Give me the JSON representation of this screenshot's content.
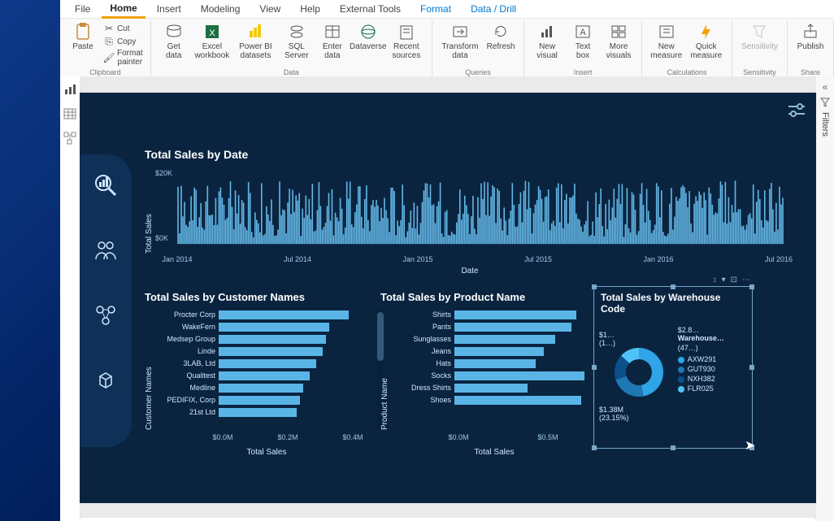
{
  "menubar": {
    "file": "File",
    "home": "Home",
    "insert": "Insert",
    "modeling": "Modeling",
    "view": "View",
    "help": "Help",
    "external_tools": "External Tools",
    "format": "Format",
    "data_drill": "Data / Drill"
  },
  "ribbon": {
    "paste": "Paste",
    "cut": "Cut",
    "copy": "Copy",
    "format_painter": "Format painter",
    "clipboard_group": "Clipboard",
    "get_data": "Get data",
    "excel_wb": "Excel workbook",
    "pbi_ds": "Power BI datasets",
    "sql_server": "SQL Server",
    "enter_data": "Enter data",
    "dataverse": "Dataverse",
    "recent_sources": "Recent sources",
    "data_group": "Data",
    "transform_data": "Transform data",
    "refresh": "Refresh",
    "queries_group": "Queries",
    "new_visual": "New visual",
    "text_box": "Text box",
    "more_visuals": "More visuals",
    "insert_group": "Insert",
    "new_measure": "New measure",
    "quick_measure": "Quick measure",
    "calc_group": "Calculations",
    "sensitivity": "Sensitivity",
    "sensitivity_group": "Sensitivity",
    "publish": "Publish",
    "share_group": "Share"
  },
  "side": {
    "filters": "Filters"
  },
  "report": {
    "ts_title": "Total Sales by Date",
    "ts_ylabel": "Total Sales",
    "ts_xlabel": "Date",
    "cust_title": "Total Sales by Customer Names",
    "cust_ylabel": "Customer Names",
    "cust_xlabel": "Total Sales",
    "prod_title": "Total Sales by Product Name",
    "prod_ylabel": "Product Name",
    "prod_xlabel": "Total Sales",
    "wh_title": "Total Sales by Warehouse Code",
    "wh_legend_header": "Warehouse…",
    "wh_val1": "$1…",
    "wh_val1b": "(1…)",
    "wh_val2": "$2.8…",
    "wh_val2b": "(47…)",
    "wh_val3": "$1.38M",
    "wh_val3b": "(23.15%)"
  },
  "chart_data": [
    {
      "id": "ts_by_date",
      "type": "bar",
      "title": "Total Sales by Date",
      "xlabel": "Date",
      "ylabel": "Total Sales",
      "ylim": [
        0,
        20000
      ],
      "x_ticks": [
        "Jan 2014",
        "Jul 2014",
        "Jan 2015",
        "Jul 2015",
        "Jan 2016",
        "Jul 2016"
      ],
      "y_ticks": [
        "$0K",
        "$20K"
      ],
      "notes": "Dense daily bars, values roughly 2K–20K; not individually legible."
    },
    {
      "id": "ts_by_customer",
      "type": "bar",
      "orientation": "horizontal",
      "title": "Total Sales by Customer Names",
      "xlabel": "Total Sales",
      "ylabel": "Customer Names",
      "xlim": [
        0,
        0.4
      ],
      "x_ticks": [
        "$0.0M",
        "$0.2M",
        "$0.4M"
      ],
      "categories": [
        "Procter Corp",
        "WakeFern",
        "Medsep Group",
        "Linde",
        "3LAB, Ltd",
        "Qualitest",
        "Medline",
        "PEDIFIX, Corp",
        "21st Ltd"
      ],
      "values": [
        0.4,
        0.34,
        0.33,
        0.32,
        0.3,
        0.28,
        0.26,
        0.25,
        0.24
      ]
    },
    {
      "id": "ts_by_product",
      "type": "bar",
      "orientation": "horizontal",
      "title": "Total Sales by Product Name",
      "xlabel": "Total Sales",
      "ylabel": "Product Name",
      "x_ticks": [
        "$0.0M",
        "$0.5M"
      ],
      "categories": [
        "Shirts",
        "Pants",
        "Sunglasses",
        "Jeans",
        "Hats",
        "Socks",
        "Dress Shirts",
        "Shoes"
      ],
      "values": [
        0.75,
        0.72,
        0.62,
        0.55,
        0.5,
        0.8,
        0.45,
        0.78
      ]
    },
    {
      "id": "ts_by_warehouse",
      "type": "pie",
      "subtype": "donut",
      "title": "Total Sales by Warehouse Code",
      "legend_title": "Warehouse…",
      "series": [
        {
          "name": "AXW291",
          "color": "#2fa4e7",
          "value": 2.8,
          "share": 0.4706
        },
        {
          "name": "GUT930",
          "color": "#1f77b4",
          "value": 1.38,
          "share": 0.2315
        },
        {
          "name": "NXH382",
          "color": "#0d4f8b",
          "value": 1.0,
          "share": 0.168
        },
        {
          "name": "FLR025",
          "color": "#4fc3f7",
          "value": 0.77,
          "share": 0.1299
        }
      ],
      "callouts": [
        "$2.8… (47…)",
        "$1.38M (23.15%)",
        "$1… (1…)"
      ]
    }
  ]
}
